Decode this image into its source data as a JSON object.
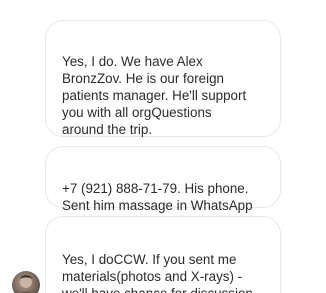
{
  "messages": [
    {
      "text": "Yes, I do. We have Alex\nBronzZov. He is our foreign\npatients manager. He'll support\nyou with all orgQuestions\naround the trip."
    },
    {
      "text": "+7 (921) 888-71-79. His phone.\nSent him massage in WhatsApp"
    },
    {
      "text": "Yes, I doCCW. If you sent me\nmaterials(photos and X-rays) -\nwe'll have chance for discussion"
    }
  ],
  "avatar": {
    "icon": "user-photo-avatar"
  }
}
